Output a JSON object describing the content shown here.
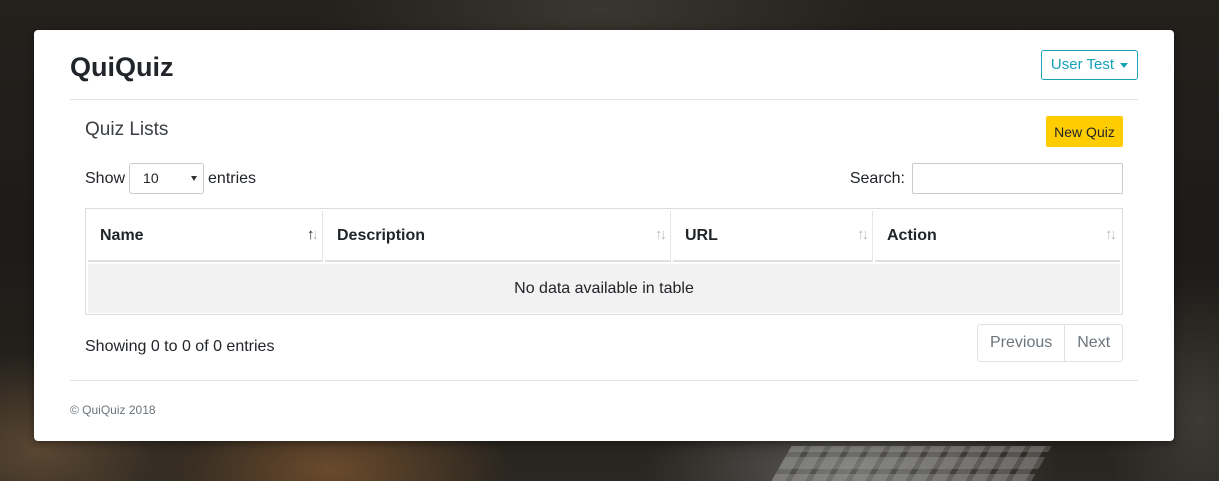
{
  "app": {
    "brand": "QuiQuiz",
    "user_menu_label": "User Test"
  },
  "section": {
    "title": "Quiz Lists",
    "new_button_label": "New Quiz"
  },
  "length_control": {
    "prefix": "Show",
    "selected_value": "10",
    "suffix": "entries"
  },
  "search": {
    "label": "Search:",
    "value": "",
    "placeholder": ""
  },
  "table": {
    "columns": [
      "Name",
      "Description",
      "URL",
      "Action"
    ],
    "sorted_column": "Name",
    "empty_message": "No data available in table"
  },
  "info_text": "Showing 0 to 0 of 0 entries",
  "pagination": {
    "previous_label": "Previous",
    "next_label": "Next"
  },
  "footer": {
    "copyright": "© QuiQuiz 2018"
  },
  "colors": {
    "accent": "#17a2b8",
    "primary_button": "#ffcc00"
  }
}
